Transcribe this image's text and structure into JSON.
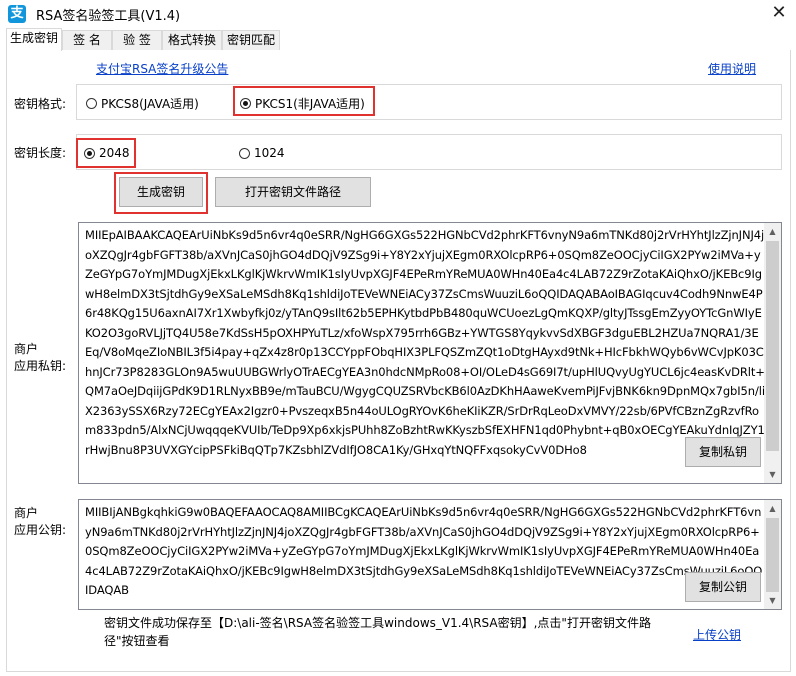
{
  "window": {
    "title": "RSA签名验签工具(V1.4)",
    "icon_glyph": "支",
    "close_glyph": "✕"
  },
  "tabs": [
    {
      "label": "生成密钥",
      "active": true
    },
    {
      "label": "签  名",
      "active": false
    },
    {
      "label": "验  签",
      "active": false
    },
    {
      "label": "格式转换",
      "active": false
    },
    {
      "label": "密钥匹配",
      "active": false
    }
  ],
  "links": {
    "upgrade_notice": "支付宝RSA签名升级公告",
    "help": "使用说明",
    "upload_public_key": "上传公钥"
  },
  "key_format": {
    "label": "密钥格式:",
    "options": [
      "PKCS8(JAVA适用)",
      "PKCS1(非JAVA适用)"
    ],
    "selected": "PKCS1(非JAVA适用)"
  },
  "key_length": {
    "label": "密钥长度:",
    "options": [
      "2048",
      "1024"
    ],
    "selected": "2048"
  },
  "buttons": {
    "generate": "生成密钥",
    "open_path": "打开密钥文件路径",
    "copy_private": "复制私钥",
    "copy_public": "复制公钥"
  },
  "private_key": {
    "label_line1": "商户",
    "label_line2": "应用私钥:",
    "text": "MIIEpAIBAAKCAQEArUiNbKs9d5n6vr4q0eSRR/NgHG6GXGs522HGNbCVd2phrKFT6vnyN9a6mTNKd80j2rVrHYhtJlzZjnJNJ4joXZQgJr4gbFGFT38b/aXVnJCaS0jhGO4dDQjV9ZSg9i+Y8Y2xYjujXEgm0RXOlcpRP6+0SQm8ZeOOCjyCiIGX2PYw2iMVa+yZeGYpG7oYmJMDugXjEkxLKglKjWkrvWmIK1sIyUvpXGJF4EPeRmYReMUA0WHn40Ea4c4LAB72Z9rZotaKAiQhxO/jKEBc9IgwH8elmDX3tSjtdhGy9eXSaLeMSdh8Kq1shldiJoTEVeWNEiACy37ZsCmsWuuziL6oQQIDAQABAoIBAGIqcuv4Codh9NnwE4P6r48KQg15U6axnAI7Xr1Xwbyfkj0z/yTAnQ9sIlt62b5EPHKytbdPbB480quWCUoezLgQmKQXP/gltyJTssgEmZyyOYTcGnWIyEKO2O3goRVLJjTQ4U58e7KdSsH5pOXHPYuTLz/xfoWspX795rrh6GBz+YWTGS8YqykvvSdXBGF3dguEBL2HZUa7NQRA1/3EEq/V8oMqeZIoNBIL3f5i4pay+qZx4z8r0p13CCYppFObqHIX3PLFQSZmZQt1oDtgHAyxd9tNk+HIcFbkhWQyb6vWCvJpK03ChnJCr73P8283GLOn9A5wuUUBGWrlyOTrAECgYEA3n0hdcNMpRo08+OI/OLeD4sG69I7t/upHlUQvyUgYUCL6jc4easKvDRlt+QM7aOeJDqiijGPdK9D1RLNyxBB9e/mTauBCU/WgygCQUZSRVbcKB6l0AzDKhHAaweKvemPiJFvjBNK6kn9DpnMQx7gbI5n/liX2363ySSX6Rzy72ECgYEAx2Igzr0+PvszeqxB5n44oULOgRYOvK6heKIiKZR/SrDrRqLeoDxVMVY/22sb/6PVfCBznZgRzvfRom833pdn5/AlxNCjUwqqqeKVUIb/TeDp9Xp6xkjsPUhh8ZoBzhtRwKKyszbSfEXHFN1qd0Phybnt+qB0xOECgYEAkuYdnIqJZY1rHwjBnu8P3UVXGYcipPSFkiBqQTp7KZsbhlZVdIfJO8CA1Ky/GHxqYtNQFFxqsokyCvV0DHo8"
  },
  "public_key": {
    "label_line1": "商户",
    "label_line2": "应用公钥:",
    "text": "MIIBIjANBgkqhkiG9w0BAQEFAAOCAQ8AMIIBCgKCAQEArUiNbKs9d5n6vr4q0eSRR/NgHG6GXGs522HGNbCVd2phrKFT6vnyN9a6mTNKd80j2rVrHYhtJlzZjnJNJ4joXZQgJr4gbFGFT38b/aXVnJCaS0jhGO4dDQjV9ZSg9i+Y8Y2xYjujXEgm0RXOlcpRP6+0SQm8ZeOOCjyCiIGX2PYw2iMVa+yZeGYpG7oYmJMDugXjEkxLKglKjWkrvWmIK1sIyUvpXGJF4EPeRmYReMUA0WHn40Ea4c4LAB72Z9rZotaKAiQhxO/jKEBc9IgwH8elmDX3tSjtdhGy9eXSaLeMSdh8Kq1shldiJoTEVeWNEiACy37ZsCmsWuuziL6oQQIDAQAB"
  },
  "status_message": "密钥文件成功保存至【D:\\ali-签名\\RSA签名验签工具windows_V1.4\\RSA密钥】,点击\"打开密钥文件路径\"按钮查看"
}
